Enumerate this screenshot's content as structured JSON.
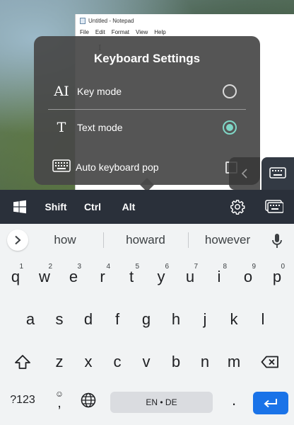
{
  "notepad": {
    "title": "Untitled - Notepad",
    "menu": [
      "File",
      "Edit",
      "Format",
      "View",
      "Help"
    ]
  },
  "settings_popup": {
    "title": "Keyboard Settings",
    "options": [
      {
        "label": "Key mode",
        "selected": false
      },
      {
        "label": "Text mode",
        "selected": true
      },
      {
        "label": "Auto keyboard pop",
        "checked": false
      }
    ],
    "icons": {
      "key_mode": "AI",
      "text_mode": "T"
    },
    "accent_color": "#7fd6c6"
  },
  "toolbar": {
    "shift": "Shift",
    "ctrl": "Ctrl",
    "alt": "Alt"
  },
  "suggestions": [
    "how",
    "howard",
    "however"
  ],
  "keyboard": {
    "row1": [
      "q",
      "w",
      "e",
      "r",
      "t",
      "y",
      "u",
      "i",
      "o",
      "p"
    ],
    "row1_hints": [
      "1",
      "2",
      "3",
      "4",
      "5",
      "6",
      "7",
      "8",
      "9",
      "0"
    ],
    "row2": [
      "a",
      "s",
      "d",
      "f",
      "g",
      "h",
      "j",
      "k",
      "l"
    ],
    "row3": [
      "z",
      "x",
      "c",
      "v",
      "b",
      "n",
      "m"
    ],
    "symbols_key": "?123",
    "comma_key": ",",
    "comma_hint": "☺",
    "space_label": "EN • DE",
    "period_key": ".",
    "enter_color": "#1a73e8"
  }
}
